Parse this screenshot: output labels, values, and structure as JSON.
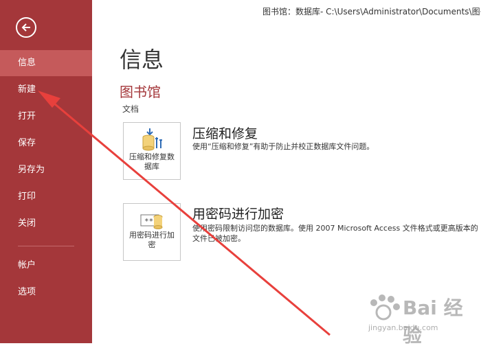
{
  "window": {
    "title": "图书馆：数据库- C:\\Users\\Administrator\\Documents\\图书"
  },
  "sidebar": {
    "items": [
      {
        "label": "信息",
        "active": true
      },
      {
        "label": "新建"
      },
      {
        "label": "打开"
      },
      {
        "label": "保存"
      },
      {
        "label": "另存为"
      },
      {
        "label": "打印"
      },
      {
        "label": "关闭"
      },
      {
        "label": "帐户"
      },
      {
        "label": "选项"
      }
    ]
  },
  "main": {
    "title": "信息",
    "db_name": "图书馆",
    "doc_label": "文档",
    "sections": [
      {
        "tile_label": "压缩和修复数据库",
        "title": "压缩和修复",
        "desc": "使用“压缩和修复”有助于防止并校正数据库文件问题。"
      },
      {
        "tile_label": "用密码进行加密",
        "title": "用密码进行加密",
        "desc": "使用密码限制访问您的数据库。使用 2007 Microsoft Access 文件格式或更高版本的文件已被加密。"
      }
    ]
  },
  "watermark": {
    "text": "Bai 经验",
    "url": "jingyan.baidu.com"
  },
  "colors": {
    "sidebar": "#a4373a",
    "active": "#c55a5b",
    "accent": "#a4373a",
    "arrow": "#e8403c"
  }
}
